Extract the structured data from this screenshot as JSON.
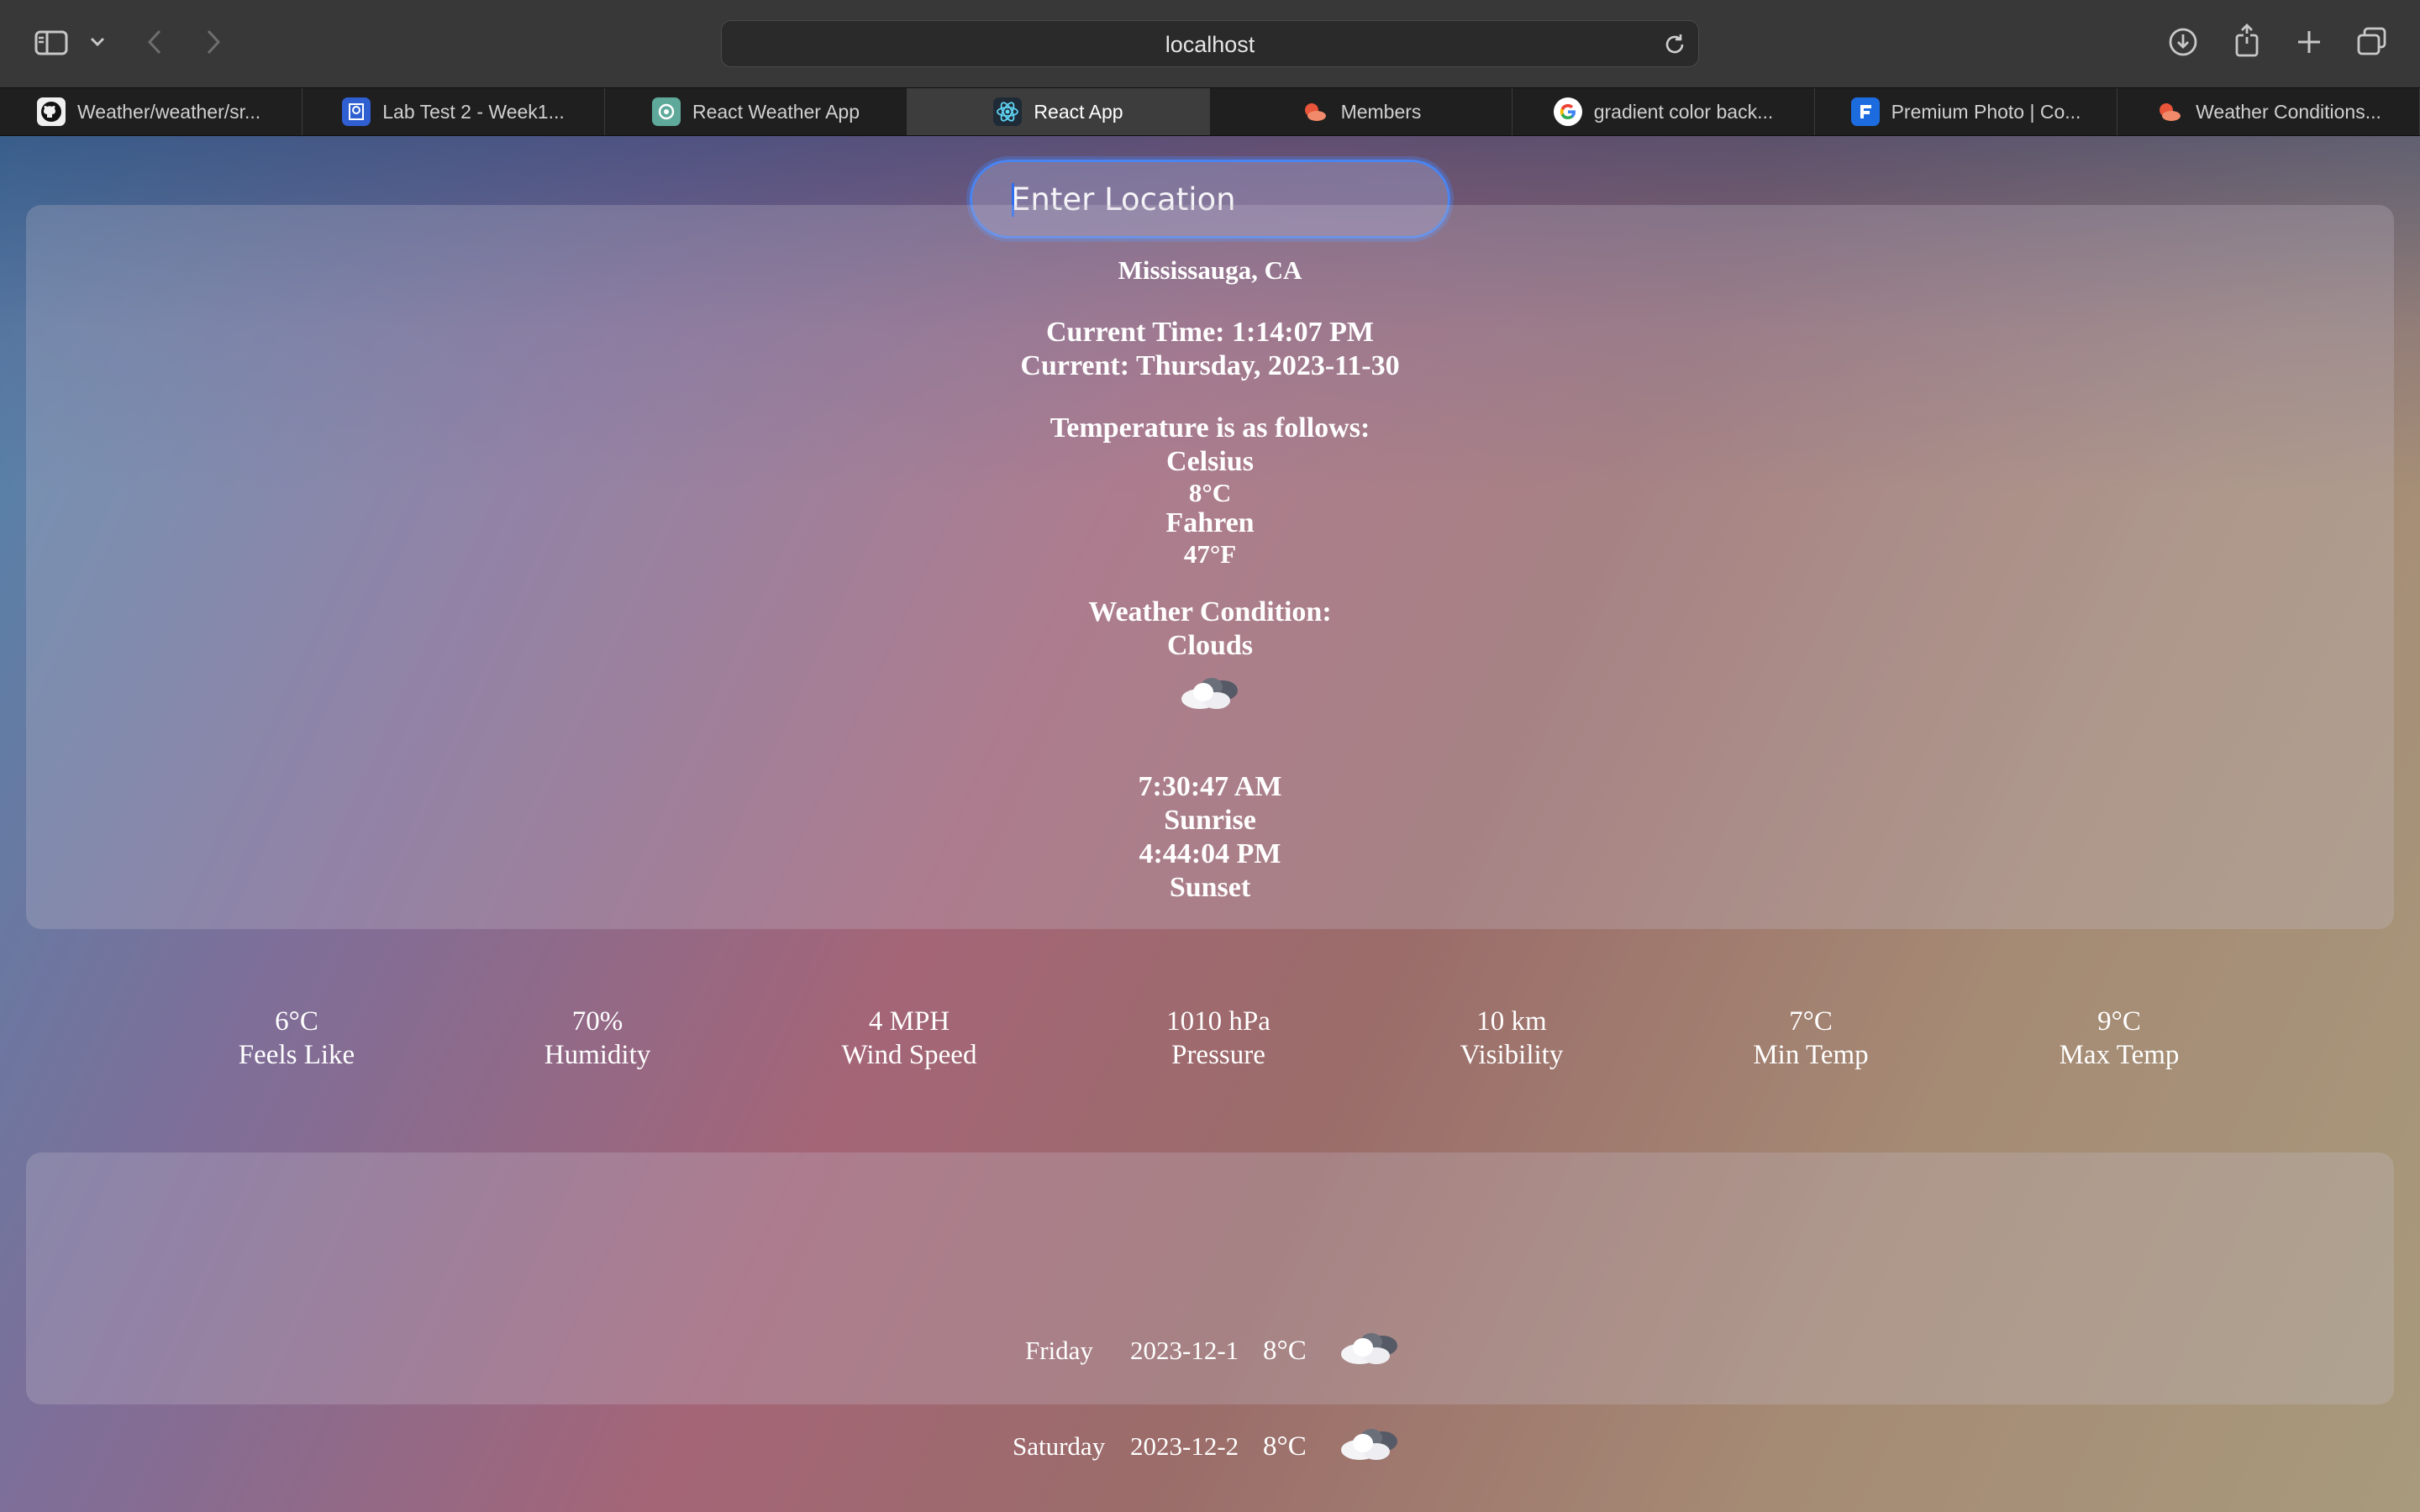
{
  "browser": {
    "url": "localhost",
    "tabs": [
      {
        "title": "Weather/weather/sr...",
        "icon": "github-icon"
      },
      {
        "title": "Lab Test 2 - Week1...",
        "icon": "lab-icon"
      },
      {
        "title": "React Weather App",
        "icon": "chatgpt-icon"
      },
      {
        "title": "React App",
        "icon": "react-icon",
        "active": true
      },
      {
        "title": "Members",
        "icon": "cloud-sun-icon"
      },
      {
        "title": "gradient color back...",
        "icon": "google-icon"
      },
      {
        "title": "Premium Photo | Co...",
        "icon": "freepik-icon"
      },
      {
        "title": "Weather Conditions...",
        "icon": "cloud-sun-icon"
      }
    ]
  },
  "search": {
    "placeholder": "Enter Location"
  },
  "weather": {
    "location": "Mississauga, CA",
    "current_time": "Current Time: 1:14:07 PM",
    "current_date": "Current: Thursday, 2023-11-30",
    "temp_heading": "Temperature is as follows:",
    "celsius_label": "Celsius",
    "celsius_value": "8°C",
    "fahren_label": "Fahren",
    "fahren_value": "47°F",
    "condition_heading": "Weather Condition:",
    "condition": "Clouds",
    "condition_icon": "cloud-icon",
    "sunrise_time": "7:30:47 AM",
    "sunrise_label": "Sunrise",
    "sunset_time": "4:44:04 PM",
    "sunset_label": "Sunset"
  },
  "stats": [
    {
      "value": "6°C",
      "label": "Feels Like"
    },
    {
      "value": "70%",
      "label": "Humidity"
    },
    {
      "value": "4 MPH",
      "label": "Wind Speed"
    },
    {
      "value": "1010 hPa",
      "label": "Pressure"
    },
    {
      "value": "10 km",
      "label": "Visibility"
    },
    {
      "value": "7°C",
      "label": "Min Temp"
    },
    {
      "value": "9°C",
      "label": "Max Temp"
    }
  ],
  "forecast": [
    {
      "day": "Friday",
      "date": "2023-12-1",
      "temp": "8°C",
      "icon": "cloud-icon"
    },
    {
      "day": "Saturday",
      "date": "2023-12-2",
      "temp": "8°C",
      "icon": "cloud-icon"
    }
  ],
  "colors": {
    "accent": "#4a84f0",
    "toolbar": "#383838",
    "tabbar": "#1f1f1f"
  }
}
